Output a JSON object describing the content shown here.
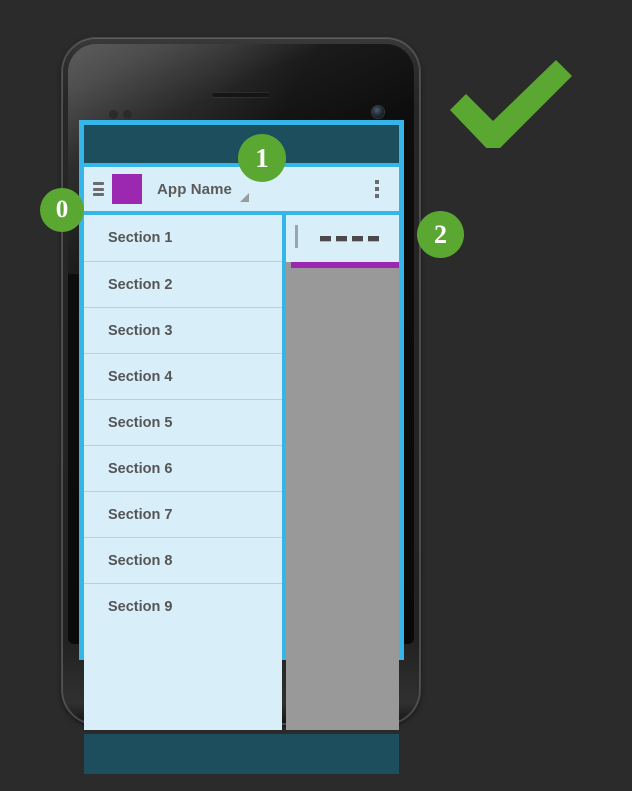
{
  "background_color": "#2b2b2b",
  "accent_colors": {
    "screen_outline": "#36b5e8",
    "status_bar": "#1d4e5e",
    "app_bar": "#d8eef9",
    "brand_purple": "#9c27b0",
    "content_gray": "#999999",
    "annotation_green": "#5aa831"
  },
  "device": {
    "name": "android-phone-mockup",
    "earpiece": "earpiece-speaker",
    "camera": "front-camera"
  },
  "screen": {
    "app_bar": {
      "menu_icon": "hamburger-icon",
      "logo": "app-logo",
      "title": "App Name",
      "spinner_caret": "dropdown-caret",
      "overflow_icon": "overflow-menu"
    },
    "section_list": {
      "items": [
        {
          "label": "Section 1"
        },
        {
          "label": "Section 2"
        },
        {
          "label": "Section 3"
        },
        {
          "label": "Section 4"
        },
        {
          "label": "Section 5"
        },
        {
          "label": "Section 6"
        },
        {
          "label": "Section 7"
        },
        {
          "label": "Section 8"
        },
        {
          "label": "Section 9"
        }
      ]
    },
    "detail_pane": {
      "cursor": "text-cursor",
      "placeholder_dashes": 4,
      "focus_underline_color": "#9c27b0"
    },
    "nav_bar": "system-navigation-bar"
  },
  "annotations": {
    "badges": [
      {
        "id": "badge-0",
        "label": "0"
      },
      {
        "id": "badge-1",
        "label": "1"
      },
      {
        "id": "badge-2",
        "label": "2"
      }
    ],
    "checkmark": "checkmark-icon"
  }
}
